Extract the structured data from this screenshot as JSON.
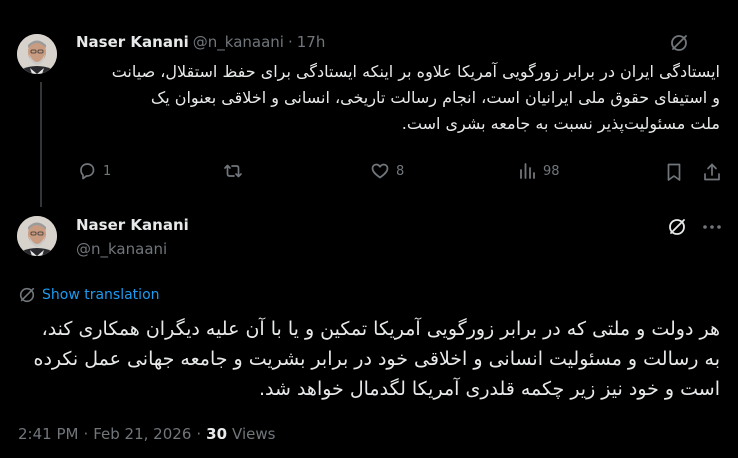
{
  "colors": {
    "background": "#000000",
    "text_primary": "#e7e9ea",
    "text_secondary": "#71767b",
    "link": "#1d9bf0",
    "thread_line": "#333639"
  },
  "tweet1": {
    "author_name": "Naser Kanani",
    "handle": "@n_kanaani",
    "separator": "·",
    "time": "17h",
    "grok_icon": "grok-icon",
    "text_lines": [
      "ایستادگی ایران در برابر زورگویی آمریکا علاوه بر اینکه ایستادگی برای حفظ استقلال، صیانت",
      "و استیفای حقوق ملی ایرانیان است، انجام رسالت تاریخی، انسانی و اخلاقی بعنوان یک",
      "ملت مسئولیت‌پذیر نسبت به جامعه بشری است."
    ],
    "actions": {
      "reply_count": "1",
      "retweet_count": "",
      "like_count": "8",
      "view_count": "98"
    }
  },
  "tweet2": {
    "author_name": "Naser Kanani",
    "handle": "@n_kanaani",
    "show_translation": "Show translation",
    "text_lines": [
      "هر دولت و ملتی که در برابر زورگویی آمریکا تمکین و یا با آن علیه دیگران همکاری کند،",
      "به رسالت و مسئولیت انسانی و اخلاقی خود در برابر بشریت و جامعه جهانی عمل نکرده",
      "است و خود نیز زیر چکمه قلدری آمریکا لگدمال خواهد شد."
    ],
    "time": "2:41 PM",
    "dot1": "·",
    "date": "Feb 21, 2026",
    "dot2": "·",
    "views_count": "30",
    "views_label": "Views"
  }
}
